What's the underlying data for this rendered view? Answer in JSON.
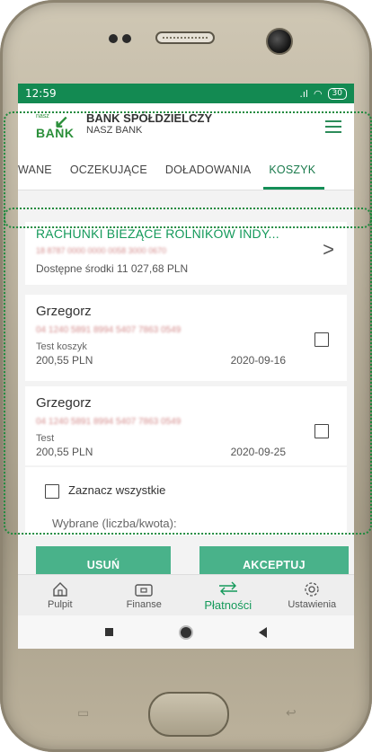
{
  "status": {
    "time": "12:59",
    "battery": "30"
  },
  "header": {
    "logo_small": "nasz",
    "logo_main": "BANK",
    "title": "BANK SPÓŁDZIELCZY",
    "subtitle": "NASZ BANK"
  },
  "tabs": [
    {
      "label": "WANE"
    },
    {
      "label": "OCZEKUJĄCE"
    },
    {
      "label": "DOŁADOWANIA"
    },
    {
      "label": "KOSZYK",
      "active": true
    }
  ],
  "account": {
    "name": "RACHUNKI BIEŻĄCE ROLNIKÓW INDY...",
    "number": "18 8787 0000 0000 0058 3000 0670",
    "balance": "Dostępne środki 11 027,68 PLN"
  },
  "orders": [
    {
      "name": "Grzegorz",
      "account": "04 1240 5891 8994 5407 7863 0549",
      "title": "Test koszyk",
      "amount": "200,55 PLN",
      "date": "2020-09-16"
    },
    {
      "name": "Grzegorz",
      "account": "04 1240 5891 8994 5407 7863 0549",
      "title": "Test",
      "amount": "200,55 PLN",
      "date": "2020-09-25"
    }
  ],
  "select_all": {
    "label": "Zaznacz wszystkie",
    "summary": "Wybrane (liczba/kwota):"
  },
  "buttons": {
    "delete": "USUŃ",
    "accept": "AKCEPTUJ"
  },
  "nav": [
    {
      "label": "Pulpit",
      "icon": "home-icon"
    },
    {
      "label": "Finanse",
      "icon": "wallet-icon"
    },
    {
      "label": "Płatności",
      "icon": "transfer-icon",
      "active": true
    },
    {
      "label": "Ustawienia",
      "icon": "gear-icon"
    }
  ],
  "colors": {
    "status_bar": "#138a52",
    "accent": "#159a5b",
    "button": "#49b28a"
  }
}
